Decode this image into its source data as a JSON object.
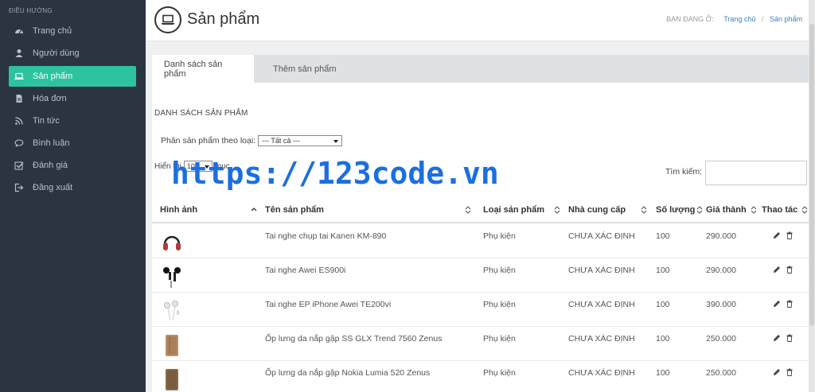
{
  "sidebar": {
    "heading": "ĐIỀU HƯỚNG",
    "items": [
      {
        "label": "Trang chủ",
        "icon": "dashboard-icon"
      },
      {
        "label": "Người dùng",
        "icon": "user-icon"
      },
      {
        "label": "Sản phẩm",
        "icon": "laptop-icon",
        "active": true
      },
      {
        "label": "Hóa đơn",
        "icon": "file-icon"
      },
      {
        "label": "Tin tức",
        "icon": "rss-icon"
      },
      {
        "label": "Bình luận",
        "icon": "comment-icon"
      },
      {
        "label": "Đánh giá",
        "icon": "check-square-icon"
      },
      {
        "label": "Đăng xuất",
        "icon": "sign-out-icon"
      }
    ]
  },
  "header": {
    "title": "Sản phẩm",
    "breadcrumb_label": "BẠN ĐANG Ở:",
    "breadcrumb_home": "Trang chủ",
    "breadcrumb_sep": "/",
    "breadcrumb_current": "Sản phẩm"
  },
  "tabs": [
    "Danh sách sản phẩm",
    "Thêm sản phẩm"
  ],
  "list": {
    "section_title": "DANH SÁCH SẢN PHẨM",
    "filter_label": "Phân sản phẩm theo loại:",
    "filter_value": "--- Tất cả ---",
    "length_prefix": "Hiển thị",
    "length_value": "10",
    "length_suffix": "mục",
    "search_label": "Tìm kiếm:",
    "columns": [
      "Hình ảnh",
      "Tên sản phẩm",
      "Loại sản phẩm",
      "Nhà cung cấp",
      "Số lượng",
      "Giá thành",
      "Thao tác"
    ],
    "rows": [
      {
        "name": "Tai nghe chụp tai Kanen KM-890",
        "category": "Phụ kiện",
        "supplier": "CHƯA XÁC ĐỊNH",
        "qty": "100",
        "price": "290.000",
        "thumb": "headphones"
      },
      {
        "name": "Tai nghe Awei ES900i",
        "category": "Phụ kiện",
        "supplier": "CHƯA XÁC ĐỊNH",
        "qty": "100",
        "price": "290.000",
        "thumb": "earbuds-black"
      },
      {
        "name": "Tai nghe EP iPhone Awei TE200vi",
        "category": "Phụ kiện",
        "supplier": "CHƯA XÁC ĐỊNH",
        "qty": "100",
        "price": "390.000",
        "thumb": "earbuds-white"
      },
      {
        "name": "Ốp lưng da nắp gập SS GLX Trend 7560 Zenus",
        "category": "Phụ kiện",
        "supplier": "CHƯA XÁC ĐỊNH",
        "qty": "100",
        "price": "250.000",
        "thumb": "case-tan"
      },
      {
        "name": "Ốp lưng da nắp gập Nokia Lumia 520 Zenus",
        "category": "Phụ kiện",
        "supplier": "CHƯA XÁC ĐỊNH",
        "qty": "100",
        "price": "250.000",
        "thumb": "case-brown"
      }
    ]
  },
  "watermark": "https://123code.vn",
  "colors": {
    "sidebar": "#2b3441",
    "accent": "#2dc3a0",
    "link": "#3a82c4",
    "watermark": "#1b6fe0"
  }
}
